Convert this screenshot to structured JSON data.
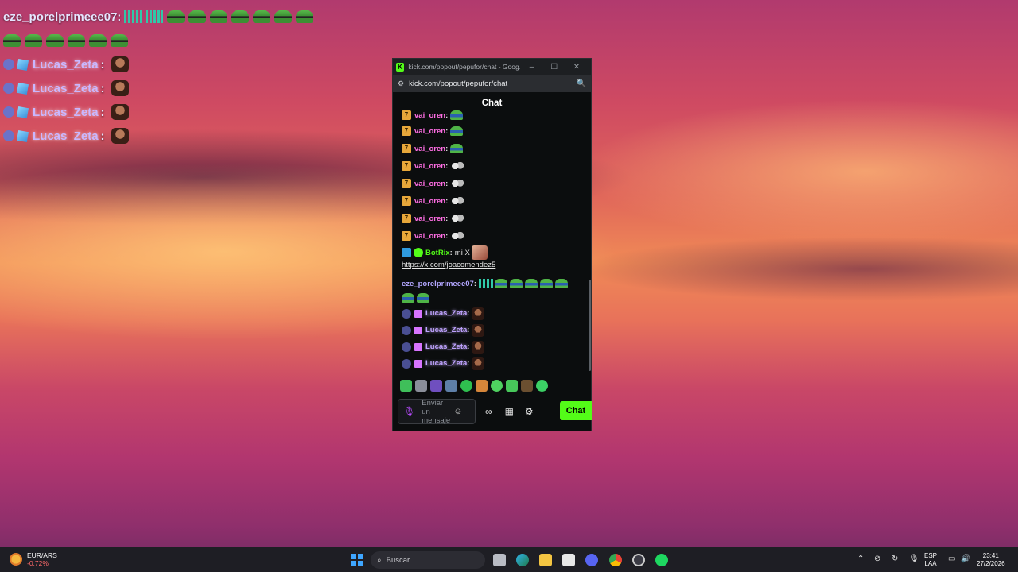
{
  "overlay": {
    "line1_user": "eze_porelprimeee07:",
    "lucas_lines": [
      {
        "user": "Lucas_Zeta",
        "colon": ":"
      },
      {
        "user": "Lucas_Zeta",
        "colon": ":"
      },
      {
        "user": "Lucas_Zeta",
        "colon": ":"
      },
      {
        "user": "Lucas_Zeta",
        "colon": ":"
      }
    ]
  },
  "window": {
    "title": "kick.com/popout/pepufor/chat - Goog...",
    "minimize": "–",
    "maximize": "☐",
    "close": "✕",
    "url": "kick.com/popout/pepufor/chat",
    "chat_title": "Chat"
  },
  "chat": {
    "vai_messages": [
      {
        "user": "vai_oren",
        "colon": ":",
        "emote": "frog-emote"
      },
      {
        "user": "vai_oren",
        "colon": ":",
        "emote": "frog-emote"
      },
      {
        "user": "vai_oren",
        "colon": ":",
        "emote": "frog-emote"
      },
      {
        "user": "vai_oren",
        "colon": ":",
        "emote": "ghost-emote"
      },
      {
        "user": "vai_oren",
        "colon": ":",
        "emote": "ghost-emote"
      },
      {
        "user": "vai_oren",
        "colon": ":",
        "emote": "ghost-emote"
      },
      {
        "user": "vai_oren",
        "colon": ":",
        "emote": "ghost-emote"
      },
      {
        "user": "vai_oren",
        "colon": ":",
        "emote": "ghost-emote"
      }
    ],
    "botrix": {
      "user": "BotRix",
      "colon": ":",
      "text": "mi X",
      "link": "https://x.com/joacomendez5"
    },
    "eze": {
      "user": "eze_porelprimeee07",
      "colon": ":"
    },
    "lucas_messages": [
      {
        "user": "Lucas_Zeta",
        "colon": ":"
      },
      {
        "user": "Lucas_Zeta",
        "colon": ":"
      },
      {
        "user": "Lucas_Zeta",
        "colon": ":"
      },
      {
        "user": "Lucas_Zeta",
        "colon": ":"
      }
    ],
    "input_placeholder": "Enviar un mensaje",
    "send_label": "Chat"
  },
  "taskbar": {
    "weather_l1": "EUR/ARS",
    "weather_l2": "-0,72%",
    "search_placeholder": "Buscar",
    "lang_l1": "ESP",
    "lang_l2": "LAA",
    "time": "23:41",
    "date": "27/2/2026"
  },
  "colors": {
    "kick_green": "#53fc18",
    "vai_pink": "#ff6ee4",
    "lucas_purple": "#bfa2ff"
  }
}
